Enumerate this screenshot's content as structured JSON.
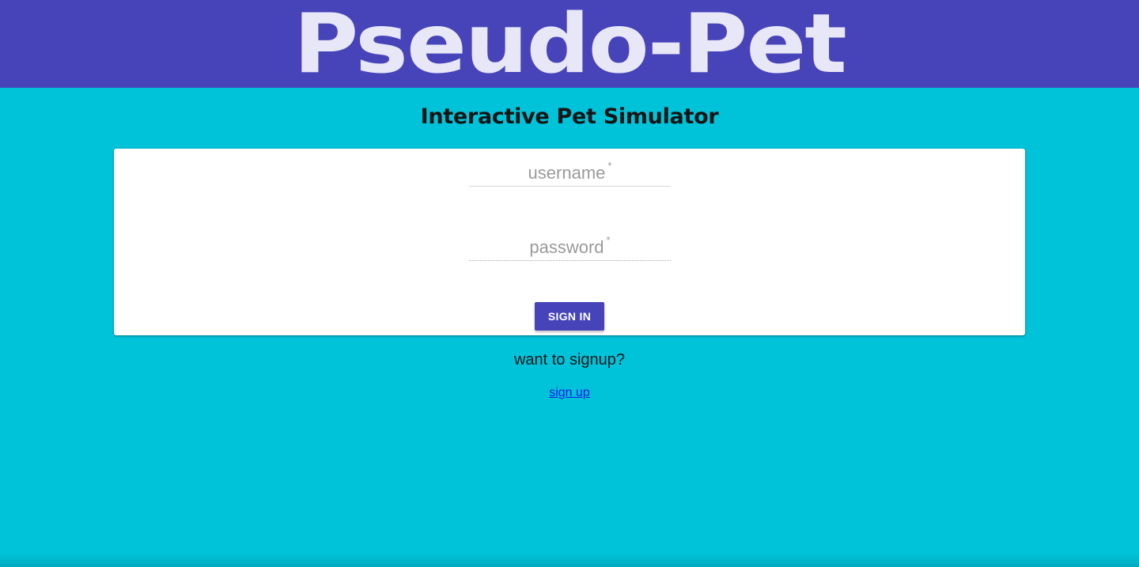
{
  "header": {
    "brand_title": "Pseudo-Pet"
  },
  "subtitle": "Interactive Pet Simulator",
  "login_form": {
    "username_label": "username",
    "password_label": "password",
    "required_mark": "*",
    "signin_label": "SIGN IN"
  },
  "signup": {
    "prompt": "want to signup?",
    "link_label": "sign up"
  },
  "colors": {
    "header_bg": "#4743b9",
    "page_bg": "#00c2d9",
    "card_bg": "#ffffff",
    "button_bg": "#4743b9",
    "link": "#1a1ae6"
  }
}
